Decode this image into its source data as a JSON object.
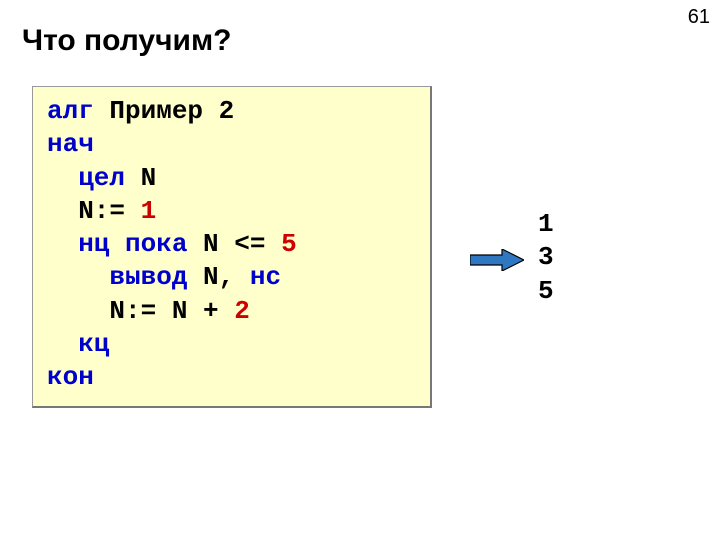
{
  "page_number": "61",
  "title": "Что получим?",
  "code": {
    "kw_alg": "алг",
    "alg_name": " Пример 2",
    "kw_nach": "нач",
    "kw_cel": "  цел",
    "decl_n": " N",
    "assign1_left": "  N:=",
    "assign1_right": "1",
    "kw_nc": "  нц",
    "kw_poka": " пока",
    "cond_left": " N <= ",
    "cond_right": "5",
    "kw_vyvod": "    вывод",
    "vyvod_args": " N, ",
    "kw_ns": "нс",
    "assign2_left": "    N:=",
    "assign2_mid": "N + ",
    "assign2_right": "2",
    "kw_kc": "  кц",
    "kw_kon": "кон"
  },
  "output_lines": [
    "1",
    "3",
    "5"
  ],
  "arrow_color": "#2f77c1",
  "arrow_border": "#000000"
}
